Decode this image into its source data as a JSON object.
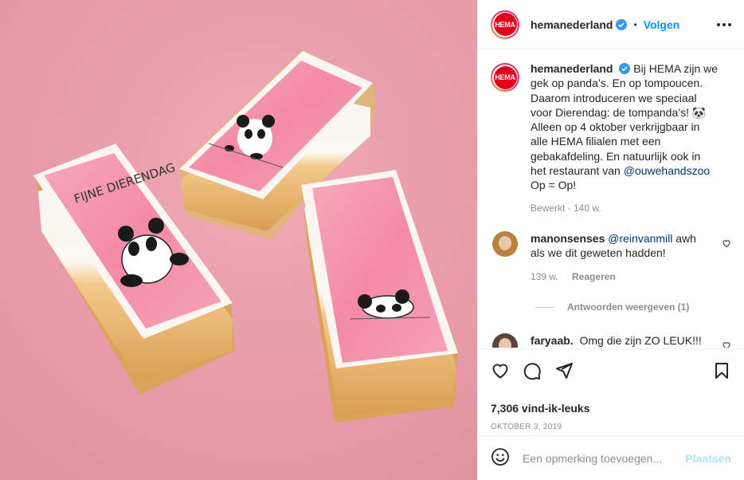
{
  "post": {
    "image_alt": "Three pink tompoucen pastries with panda prints on a pink background",
    "cake_text": "FIJNE DIERENDAG"
  },
  "header": {
    "avatar_text": "HEMA",
    "username": "hemanederland",
    "separator": "•",
    "follow_label": "Volgen"
  },
  "caption": {
    "username": "hemanederland",
    "text_before": "Bij HEMA zijn we gek op panda’s. En op tompoucen. Daarom introduceren we speciaal voor Dierendag: de tompanda’s! 🐼 Alleen op 4 oktober verkrijgbaar in alle HEMA filialen met een gebakafdeling. En natuurlijk ook in het restaurant van ",
    "mention": "@ouwehandszoo",
    "text_after": " Op = Op!",
    "meta": "Bewerkt · 140 w."
  },
  "comments": [
    {
      "username": "manonsenses",
      "mention": "@reinvanmill",
      "text": " awh als we dit geweten hadden!",
      "age": "139 w.",
      "reply_label": "Reageren",
      "view_replies": "Antwoorden weergeven (1)"
    },
    {
      "username": "faryaab.",
      "text": "Omg die zijn ZO LEUK!!!"
    }
  ],
  "actions": {
    "likes": "7,306 vind-ik-leuks",
    "date": "OKTOBER 3, 2019"
  },
  "add_comment": {
    "placeholder": "Een opmerking toevoegen...",
    "post_label": "Plaatsen"
  },
  "colors": {
    "follow_blue": "#0095f6",
    "hema_red": "#e3001b",
    "background_pink": "#ec9fac"
  }
}
